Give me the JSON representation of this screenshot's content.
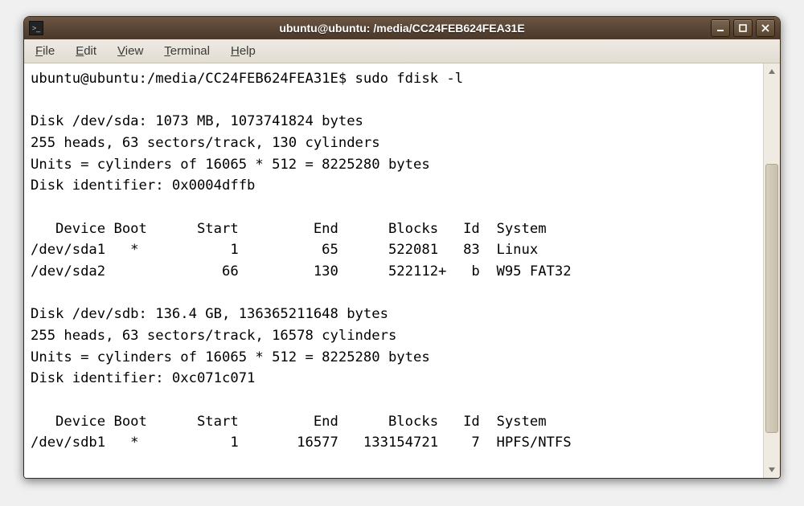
{
  "window": {
    "title": "ubuntu@ubuntu: /media/CC24FEB624FEA31E"
  },
  "menubar": {
    "items": [
      {
        "accel": "F",
        "rest": "ile"
      },
      {
        "accel": "E",
        "rest": "dit"
      },
      {
        "accel": "V",
        "rest": "iew"
      },
      {
        "accel": "T",
        "rest": "erminal"
      },
      {
        "accel": "H",
        "rest": "elp"
      }
    ]
  },
  "terminal": {
    "prompt": "ubuntu@ubuntu:/media/CC24FEB624FEA31E$ ",
    "command": "sudo fdisk -l",
    "lines": [
      "",
      "Disk /dev/sda: 1073 MB, 1073741824 bytes",
      "255 heads, 63 sectors/track, 130 cylinders",
      "Units = cylinders of 16065 * 512 = 8225280 bytes",
      "Disk identifier: 0x0004dffb",
      "",
      "   Device Boot      Start         End      Blocks   Id  System",
      "/dev/sda1   *           1          65      522081   83  Linux",
      "/dev/sda2              66         130      522112+   b  W95 FAT32",
      "",
      "Disk /dev/sdb: 136.4 GB, 136365211648 bytes",
      "255 heads, 63 sectors/track, 16578 cylinders",
      "Units = cylinders of 16065 * 512 = 8225280 bytes",
      "Disk identifier: 0xc071c071",
      "",
      "   Device Boot      Start         End      Blocks   Id  System",
      "/dev/sdb1   *           1       16577   133154721    7  HPFS/NTFS"
    ]
  }
}
